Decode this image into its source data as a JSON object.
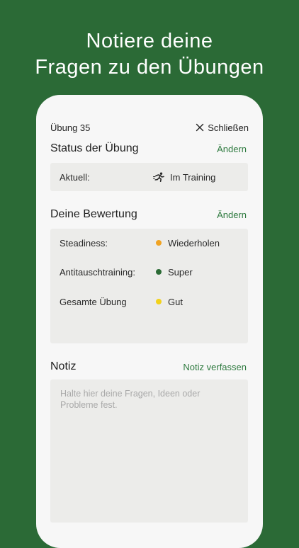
{
  "headline": {
    "line1": "Notiere deine",
    "line2": "Fragen zu den Übungen"
  },
  "topbar": {
    "title": "Übung 35",
    "close_label": "Schließen",
    "close_icon": "close-icon"
  },
  "status": {
    "title": "Status der Übung",
    "edit_label": "Ändern",
    "row_key": "Aktuell:",
    "row_value": "Im Training",
    "row_icon": "running-person-icon"
  },
  "rating": {
    "title": "Deine Bewertung",
    "edit_label": "Ändern",
    "rows": [
      {
        "key": "Steadiness:",
        "value": "Wiederholen",
        "color": "#f0a323"
      },
      {
        "key": "Antitauschtraining:",
        "value": "Super",
        "color": "#2c6b36"
      },
      {
        "key": "Gesamte Übung",
        "value": "Gut",
        "color": "#f2d21b"
      }
    ]
  },
  "note": {
    "title": "Notiz",
    "action_label": "Notiz verfassen",
    "value": "",
    "placeholder": "Halte hier deine Fragen, Ideen oder Probleme fest."
  },
  "colors": {
    "background": "#2b6a36",
    "accent": "#2e7a3f",
    "card": "#ececea",
    "panel": "#f7f7f7"
  }
}
